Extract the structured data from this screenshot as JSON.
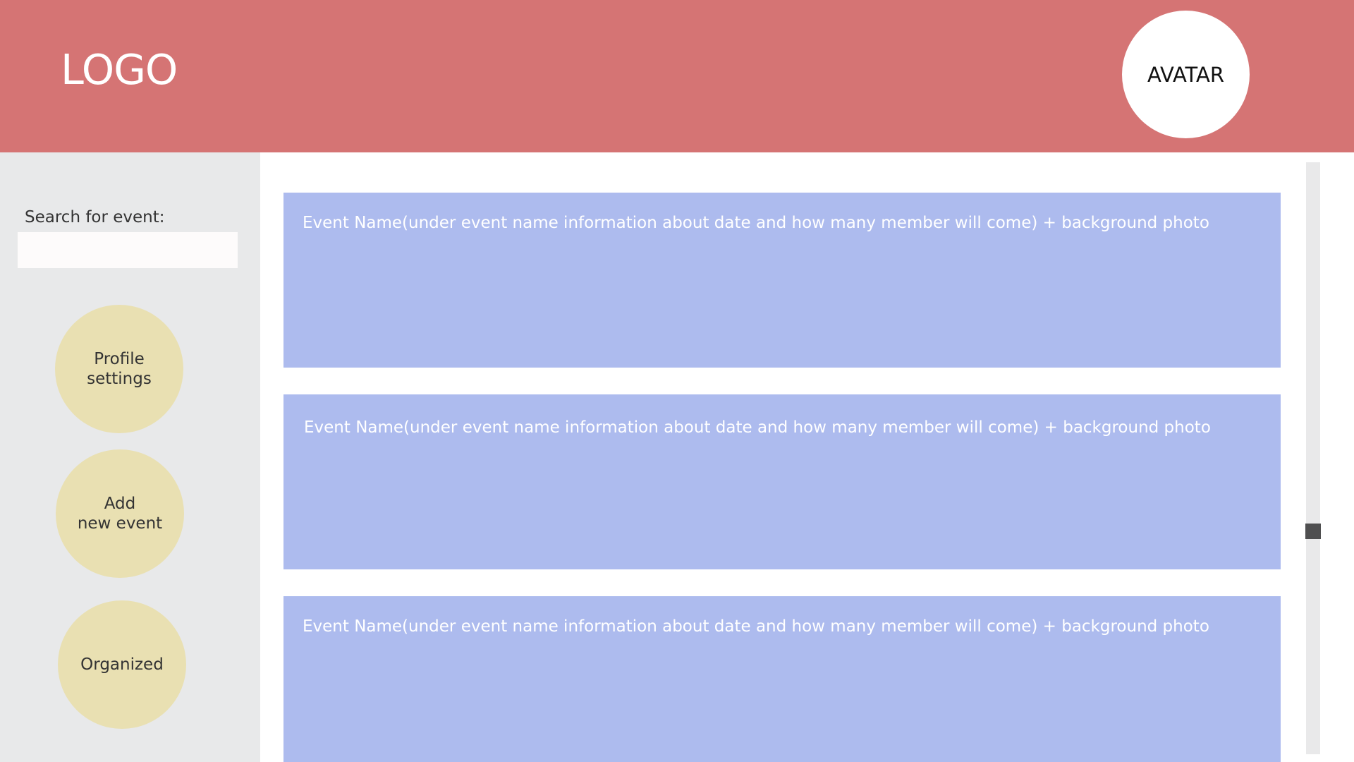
{
  "header": {
    "logo": "LOGO",
    "avatar_label": "AVATAR",
    "background_color": "#d57474"
  },
  "sidebar": {
    "search_label": "Search for event:",
    "search_value": "",
    "nav": [
      {
        "label": "Profile\nsettings"
      },
      {
        "label": "Add\nnew event"
      },
      {
        "label": "Organized"
      }
    ],
    "nav_color": "#e9e0b2"
  },
  "events": [
    {
      "label": "Event Name(under event name information about date and how many member will come) + background photo"
    },
    {
      "label": "Event Name(under event name information about date and how many member will come) + background photo"
    },
    {
      "label": "Event Name(under event name information about date and how many member will come) + background photo"
    }
  ],
  "event_color": "#adbbee"
}
